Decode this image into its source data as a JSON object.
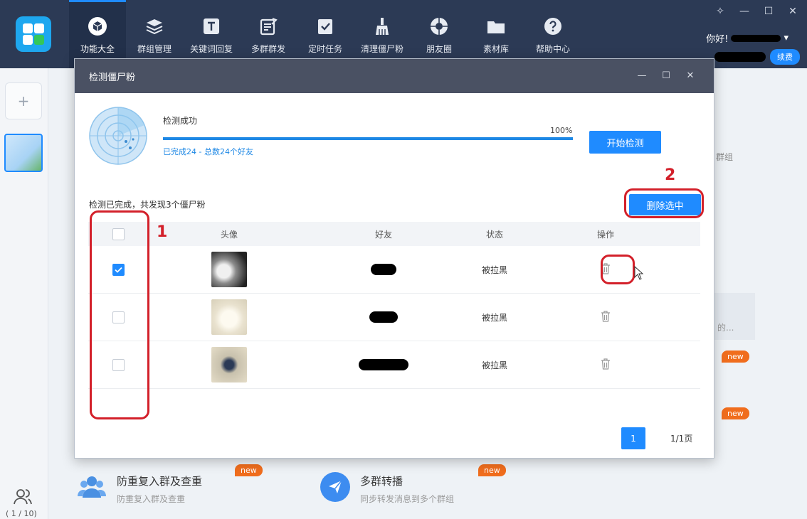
{
  "nav": {
    "items": [
      {
        "label": "功能大全",
        "icon": "cube-icon"
      },
      {
        "label": "群组管理",
        "icon": "layers-icon"
      },
      {
        "label": "关键词回复",
        "icon": "text-t-icon"
      },
      {
        "label": "多群群发",
        "icon": "edit-document-icon"
      },
      {
        "label": "定时任务",
        "icon": "clipboard-check-icon"
      },
      {
        "label": "清理僵尸粉",
        "icon": "broom-icon"
      },
      {
        "label": "朋友圈",
        "icon": "aperture-icon"
      },
      {
        "label": "素材库",
        "icon": "folder-icon"
      },
      {
        "label": "帮助中心",
        "icon": "help-icon"
      }
    ]
  },
  "header": {
    "greeting": "你好!",
    "renew_label": "续费"
  },
  "rail": {
    "add_label": "+",
    "account_count": "( 1 / 10)"
  },
  "background": {
    "side_text_1": "群组",
    "side_text_2": "的...",
    "new_badge": "new",
    "feature_1": {
      "title": "防重复入群及查重",
      "desc": "防重复入群及查重"
    },
    "feature_2": {
      "title": "多群转播",
      "desc": "同步转发消息到多个群组"
    }
  },
  "dialog": {
    "title": "检测僵尸粉",
    "scan_status": "检测成功",
    "progress_label": "100%",
    "progress_value": 1.0,
    "scan_summary": "已完成24 - 总数24个好友",
    "start_button": "开始检测",
    "result_text": "检测已完成，共发现3个僵尸粉",
    "delete_selected_button": "删除选中",
    "table": {
      "headers": {
        "avatar": "头像",
        "friend": "好友",
        "status": "状态",
        "action": "操作"
      },
      "rows": [
        {
          "checked": true,
          "status": "被拉黑"
        },
        {
          "checked": false,
          "status": "被拉黑"
        },
        {
          "checked": false,
          "status": "被拉黑"
        }
      ]
    },
    "pager": {
      "current": "1",
      "info": "1/1页"
    }
  },
  "annotations": {
    "label_1": "1",
    "label_2": "2"
  },
  "colors": {
    "topbar": "#2c3a55",
    "accent": "#1f8bff",
    "annotation": "#d3202a",
    "new_badge": "#f06d1d"
  }
}
